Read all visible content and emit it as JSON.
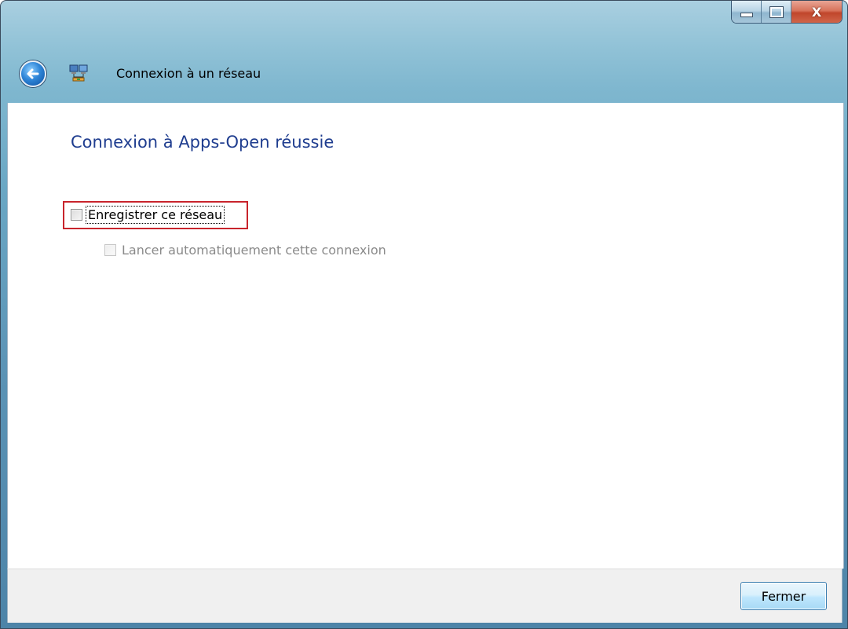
{
  "window": {
    "title": "Connexion à un réseau",
    "caption_buttons": {
      "minimize": "–",
      "maximize": "□",
      "close": "X"
    }
  },
  "main": {
    "heading": "Connexion à Apps-Open réussie",
    "save_network_label": "Enregistrer ce réseau",
    "save_network_checked": false,
    "auto_connect_label": "Lancer automatiquement cette connexion",
    "auto_connect_checked": false,
    "auto_connect_enabled": false
  },
  "footer": {
    "close_label": "Fermer"
  },
  "colors": {
    "heading": "#1f3d8f",
    "highlight": "#c8242c",
    "disabled_text": "#8a8a8a"
  },
  "icons": {
    "back": "back-arrow-icon",
    "network": "network-icon"
  }
}
